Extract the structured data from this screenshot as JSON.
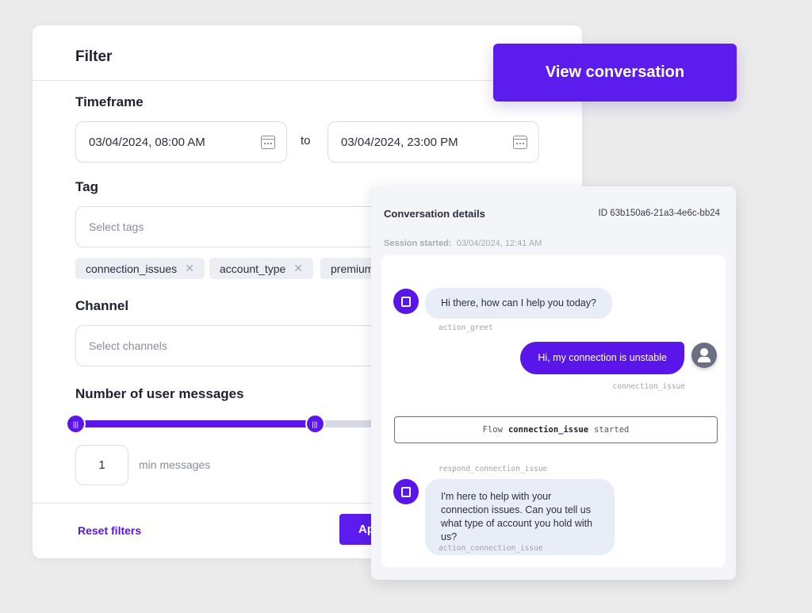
{
  "filter": {
    "title": "Filter",
    "timeframe": {
      "label": "Timeframe",
      "from": "03/04/2024, 08:00 AM",
      "separator": "to",
      "to": "03/04/2024, 23:00 PM"
    },
    "tag": {
      "label": "Tag",
      "placeholder": "Select tags",
      "selected": [
        "connection_issues",
        "account_type",
        "premium"
      ]
    },
    "channel": {
      "label": "Channel",
      "placeholder": "Select channels"
    },
    "messages": {
      "label": "Number of user messages",
      "min_value": "1",
      "min_label": "min messages",
      "slider_range_fraction": [
        0,
        0.67
      ]
    },
    "reset_label": "Reset filters",
    "apply_label": "Apply"
  },
  "view_conversation_label": "View conversation",
  "conversation": {
    "title": "Conversation details",
    "id": "ID 63b150a6-21a3-4e6c-bb24",
    "session_label": "Session started:",
    "session_value": "03/04/2024, 12:41 AM",
    "messages": [
      {
        "from": "bot",
        "text": "Hi there, how can I help you today?",
        "action": "action_greet"
      },
      {
        "from": "user",
        "text": "Hi, my connection is unstable",
        "action": "connection_issue"
      }
    ],
    "flow": {
      "prefix": "Flow",
      "name": "connection_issue",
      "suffix": "started"
    },
    "bot_reply": {
      "pre_action": "respond_connection_issue",
      "text": "I'm here to help with your connection issues. Can you tell us what type of account you hold with us?",
      "action": "action_connection_issue"
    }
  },
  "colors": {
    "accent": "#5b1ced",
    "background": "#ebebec"
  }
}
